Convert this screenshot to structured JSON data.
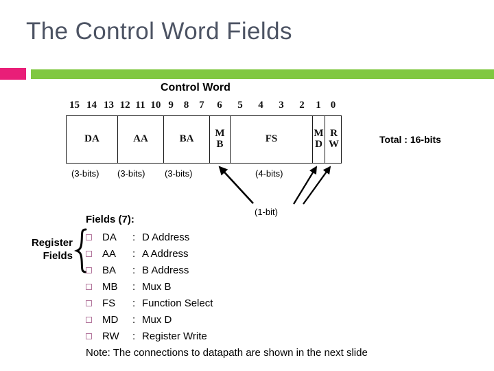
{
  "slide": {
    "title": "The Control Word Fields",
    "note": "Note: The connections to datapath are shown in the next slide"
  },
  "colors": {
    "title": "#4c5363",
    "accent_pink": "#e91e78",
    "accent_green": "#80c841",
    "bullet": "#b4789e",
    "text": "#000000"
  },
  "diagram": {
    "heading": "Control Word",
    "total_label": "Total : 16-bits",
    "bit_numbers": [
      "15",
      "14",
      "13",
      "12",
      "11",
      "10",
      "9",
      "8",
      "7",
      "6",
      "5",
      "4",
      "3",
      "2",
      "1",
      "0"
    ],
    "cells": [
      {
        "name": "DA",
        "lines": [
          "DA"
        ],
        "bits": 3
      },
      {
        "name": "AA",
        "lines": [
          "AA"
        ],
        "bits": 3
      },
      {
        "name": "BA",
        "lines": [
          "BA"
        ],
        "bits": 3
      },
      {
        "name": "MB",
        "lines": [
          "M",
          "B"
        ],
        "bits": 1
      },
      {
        "name": "FS",
        "lines": [
          "FS"
        ],
        "bits": 4
      },
      {
        "name": "MD",
        "lines": [
          "M",
          "D"
        ],
        "bits": 1
      },
      {
        "name": "RW",
        "lines": [
          "R",
          "W"
        ],
        "bits": 1
      }
    ],
    "width_labels": {
      "da": "(3-bits)",
      "aa": "(3-bits)",
      "ba": "(3-bits)",
      "fs": "(4-bits)",
      "one_bit": "(1-bit)"
    }
  },
  "fields": {
    "heading": "Fields (7):",
    "group_label_line1": "Register",
    "group_label_line2": "Fields",
    "colon": ":",
    "items": [
      {
        "abbr": "DA",
        "desc": "D Address"
      },
      {
        "abbr": "AA",
        "desc": "A Address"
      },
      {
        "abbr": "BA",
        "desc": "B Address"
      },
      {
        "abbr": "MB",
        "desc": "Mux B"
      },
      {
        "abbr": "FS",
        "desc": "Function Select"
      },
      {
        "abbr": "MD",
        "desc": "Mux D"
      },
      {
        "abbr": "RW",
        "desc": "Register Write"
      }
    ]
  }
}
